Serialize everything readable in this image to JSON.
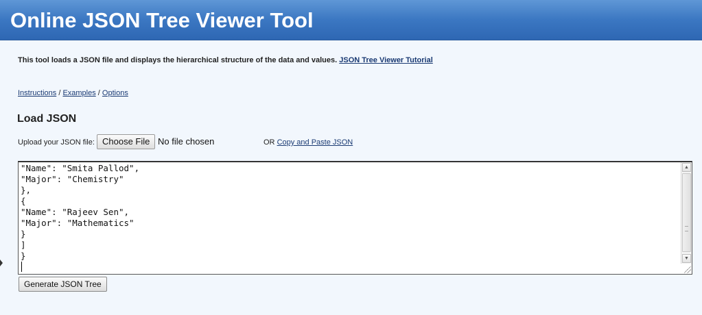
{
  "header": {
    "title": "Online JSON Tree Viewer Tool",
    "background": "#3b77c2"
  },
  "intro": {
    "text": "This tool loads a JSON file and displays the hierarchical structure of the data and values.",
    "tutorial_link": "JSON Tree Viewer Tutorial"
  },
  "nav": {
    "instructions": "Instructions",
    "separator": "/",
    "examples": "Examples",
    "options": "Options"
  },
  "load_section": {
    "title": "Load JSON",
    "upload_label": "Upload your JSON file:",
    "choose_file_button": "Choose File",
    "file_status": "No file chosen",
    "or_label": "OR",
    "paste_link": "Copy and Paste JSON"
  },
  "editor": {
    "lines": [
      "\"Name\": \"Smita Pallod\",",
      "\"Major\": \"Chemistry\"",
      "},",
      "{",
      "\"Name\": \"Rajeev Sen\",",
      "\"Major\": \"Mathematics\"",
      "}",
      "]",
      "}"
    ],
    "icons": {
      "scroll_up": "arrow-up-icon",
      "scroll_down": "arrow-down-icon",
      "resize": "resize-grip-icon"
    }
  },
  "actions": {
    "generate_button": "Generate JSON Tree"
  },
  "colors": {
    "page_background": "#f2f7fd",
    "link": "#1a3a73"
  }
}
